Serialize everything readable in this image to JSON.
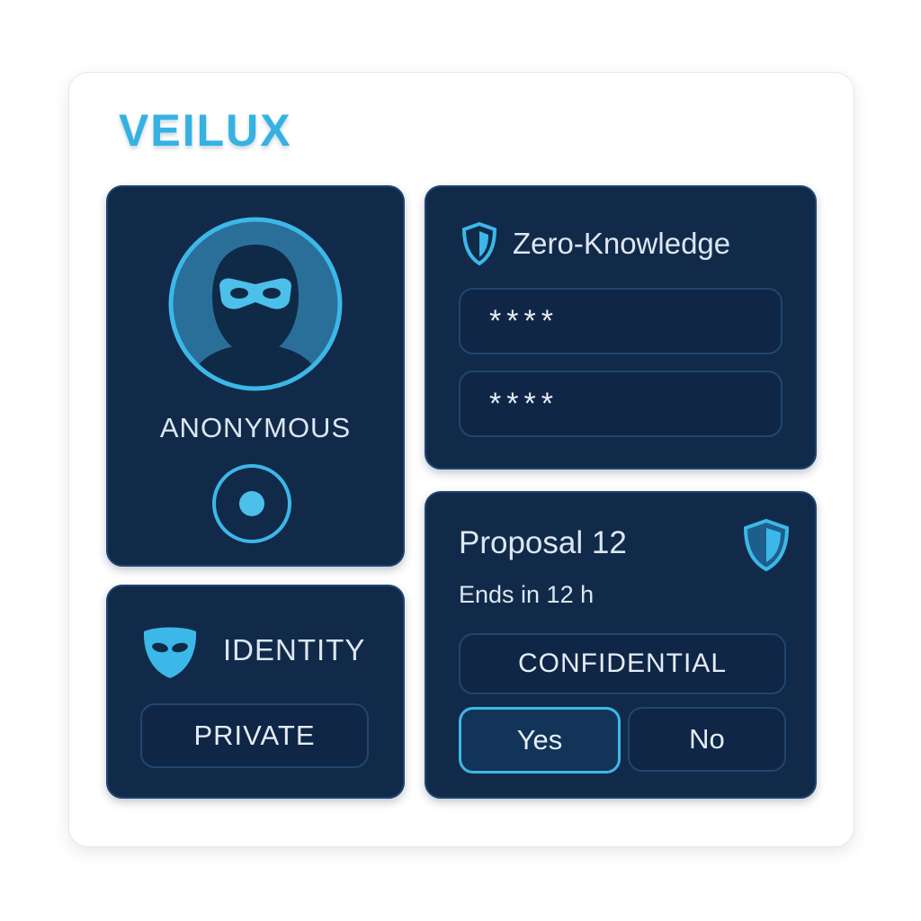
{
  "brand": {
    "name": "VEILUX",
    "color": "#35b2e2"
  },
  "profile_card": {
    "avatar_icon": "masked-user-icon",
    "label": "ANONYMOUS",
    "toggle_icon": "radio-selected-icon"
  },
  "identity_card": {
    "icon": "mask-icon",
    "title": "IDENTITY",
    "status": "PRIVATE"
  },
  "zk_card": {
    "icon": "shield-icon",
    "title": "Zero-Knowledge",
    "fields": [
      {
        "value": "****"
      },
      {
        "value": "****"
      }
    ]
  },
  "proposal_card": {
    "title": "Proposal 12",
    "subtitle": "Ends in 12 h",
    "icon": "shield-icon",
    "badge": "CONFIDENTIAL",
    "yes_label": "Yes",
    "no_label": "No"
  },
  "colors": {
    "card_bg": "#112a4a",
    "card_border": "#1e4470",
    "accent": "#35b2e2",
    "text": "#dde7f2"
  }
}
